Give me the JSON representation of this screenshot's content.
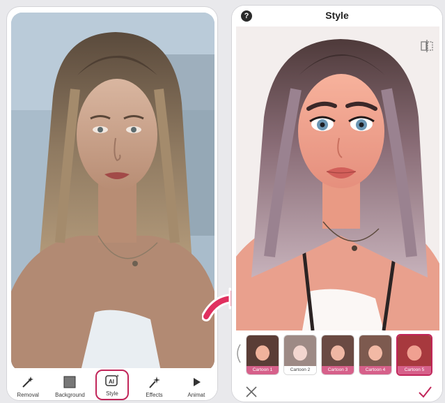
{
  "left_screen": {
    "toolbar": [
      {
        "label": "Removal",
        "icon": "magic-wand-icon"
      },
      {
        "label": "Background",
        "icon": "background-icon"
      },
      {
        "label": "Style",
        "icon": "ai-style-icon",
        "active": true
      },
      {
        "label": "Effects",
        "icon": "effects-icon"
      },
      {
        "label": "Animat",
        "icon": "animate-icon"
      }
    ]
  },
  "right_screen": {
    "title": "Style",
    "help_icon": "?",
    "styles": [
      "Cartoon 1",
      "Cartoon 2",
      "Cartoon 3",
      "Cartoon 4",
      "Cartoon 5"
    ],
    "selected_style": "Cartoon 5"
  },
  "colors": {
    "accent": "#c1265a",
    "label_pink": "#d6608a"
  }
}
